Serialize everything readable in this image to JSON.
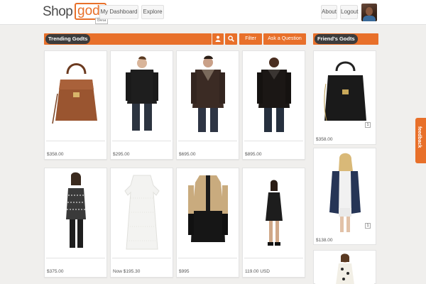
{
  "header": {
    "logo_main": "Shop",
    "logo_accent": "godt",
    "logo_badge": "Beta",
    "nav": {
      "dashboard": "My Dashboard",
      "explore": "Explore",
      "about": "About",
      "logout": "Logout"
    }
  },
  "trending": {
    "title": "Trending Godts",
    "filter_label": "Filter",
    "ask_label": "Ask a Question",
    "items": [
      {
        "price": "$358.00",
        "kind": "brown-bag"
      },
      {
        "price": "$295.00",
        "kind": "black-jacket"
      },
      {
        "price": "$695.00",
        "kind": "leather-jacket"
      },
      {
        "price": "$895.00",
        "kind": "leather-jacket"
      },
      {
        "price": "$375.00",
        "kind": "patterned-top"
      },
      {
        "price": "Now  $195.30",
        "kind": "white-dress"
      },
      {
        "price": "$995",
        "kind": "colorblock-coat"
      },
      {
        "price": "119.00 USD",
        "kind": "black-dress"
      }
    ]
  },
  "friends": {
    "title": "Friend's Godts",
    "items": [
      {
        "price": "$358.00",
        "count": "1",
        "kind": "black-bag"
      },
      {
        "price": "$138.00",
        "count": "1",
        "kind": "navy-cardigan"
      },
      {
        "kind": "floral-dress"
      }
    ]
  },
  "feedback_label": "feedback",
  "colors": {
    "accent": "#e8702a",
    "bar_label_bg": "#3c3c3c",
    "page_bg": "#f0efed"
  },
  "icons": [
    "user-icon",
    "search-icon"
  ]
}
